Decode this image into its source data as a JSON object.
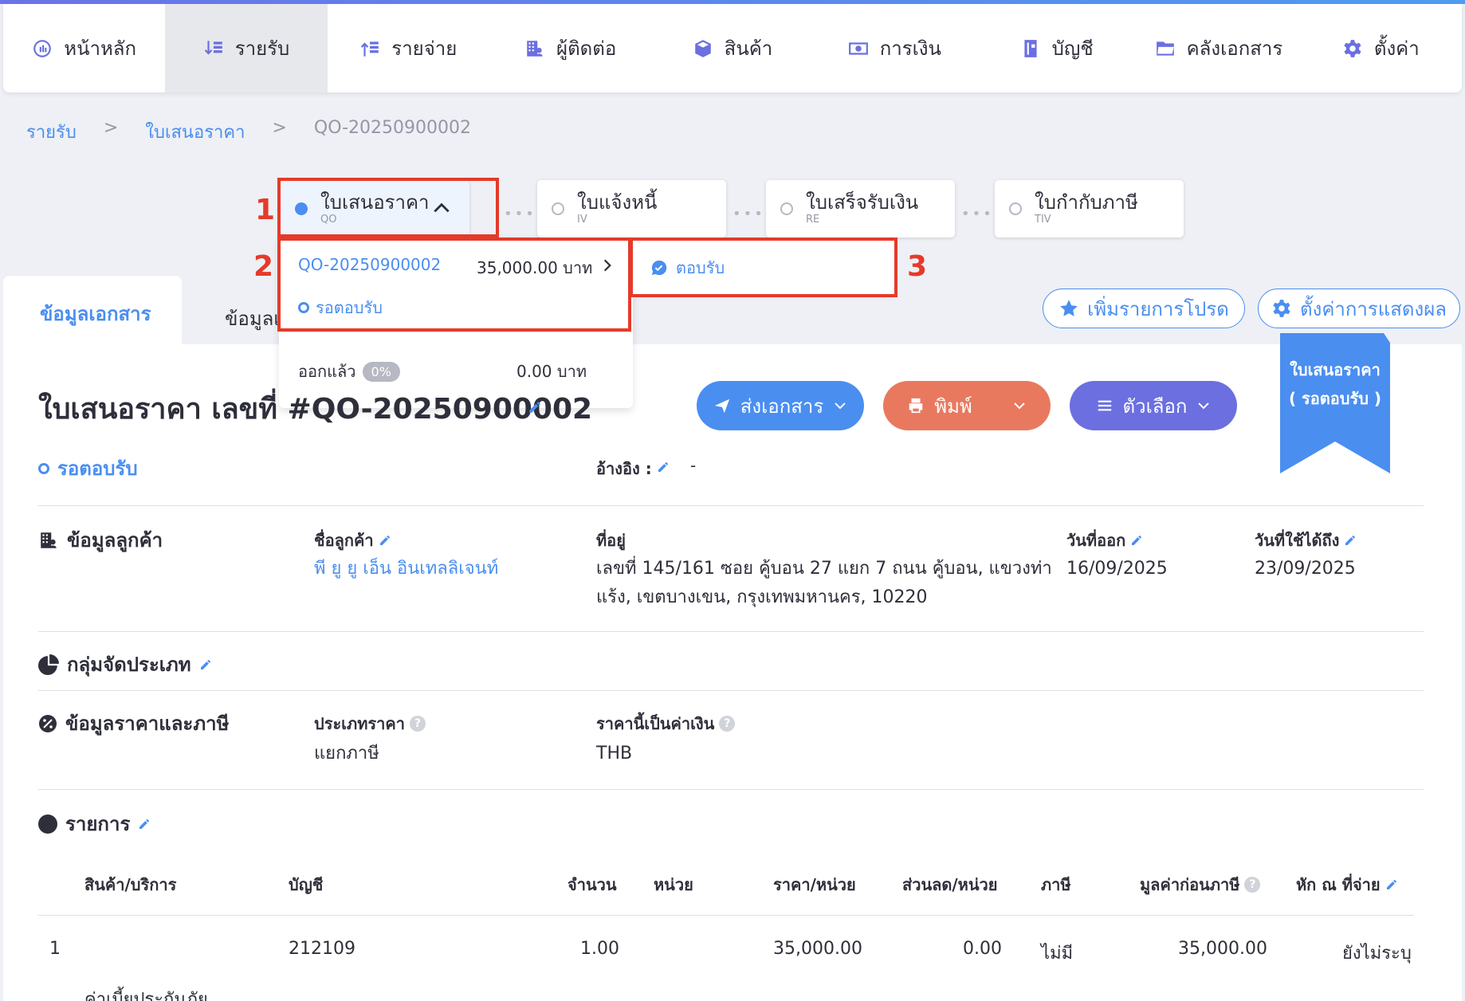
{
  "nav": [
    {
      "label": "หน้าหลัก",
      "icon": "dashboard-icon",
      "active": false
    },
    {
      "label": "รายรับ",
      "icon": "income-icon",
      "active": true
    },
    {
      "label": "รายจ่าย",
      "icon": "expense-icon",
      "active": false
    },
    {
      "label": "ผู้ติดต่อ",
      "icon": "contacts-icon",
      "active": false
    },
    {
      "label": "สินค้า",
      "icon": "box-icon",
      "active": false
    },
    {
      "label": "การเงิน",
      "icon": "money-icon",
      "active": false
    },
    {
      "label": "บัญชี",
      "icon": "book-icon",
      "active": false
    },
    {
      "label": "คลังเอกสาร",
      "icon": "folder-icon",
      "active": false
    },
    {
      "label": "ตั้งค่า",
      "icon": "gear-icon",
      "active": false
    }
  ],
  "breadcrumb": {
    "root": "รายรับ",
    "sep": ">",
    "section": "ใบเสนอราคา",
    "current": "QO-20250900002"
  },
  "steps": [
    {
      "title": "ใบเสนอราคา",
      "code": "QO"
    },
    {
      "title": "ใบแจ้งหนี้",
      "code": "IV"
    },
    {
      "title": "ใบเสร็จรับเงิน",
      "code": "RE"
    },
    {
      "title": "ใบกำกับภาษี",
      "code": "TIV"
    }
  ],
  "annotations": {
    "one": "1",
    "two": "2",
    "three": "3"
  },
  "dropdown": {
    "doc_no": "QO-20250900002",
    "amount": "35,000.00 บาท",
    "status": "รอตอบรับ",
    "issued_label": "ออกแล้ว",
    "issued_pct": "0%",
    "issued_amount": "0.00 บาท"
  },
  "accept_action": "ตอบรับ",
  "tabs": {
    "doc_info": "ข้อมูลเอกสาร",
    "other": "ข้อมูลเ"
  },
  "buttons": {
    "add_favorite": "เพิ่มรายการโปรด",
    "display_settings": "ตั้งค่าการแสดงผล",
    "send": "ส่งเอกสาร",
    "print": "พิมพ์",
    "options": "ตัวเลือก"
  },
  "ribbon": {
    "line1": "ใบเสนอราคา",
    "line2": "( รอตอบรับ )"
  },
  "document": {
    "title": "ใบเสนอราคา เลขที่ #QO-20250900002",
    "status": "รอตอบรับ",
    "ref_label": "อ้างอิง :",
    "ref_value": "-"
  },
  "customer": {
    "section": "ข้อมูลลูกค้า",
    "name_label": "ชื่อลูกค้า",
    "name": "พี ยู ยู เอ็น อินเทลลิเจนท์",
    "address_label": "ที่อยู่",
    "address_line1": "เลขที่ 145/161 ซอย คู้บอน 27 แยก 7 ถนน คู้บอน, แขวงท่า",
    "address_line2": "แร้ง, เขตบางเขน, กรุงเทพมหานคร, 10220",
    "issue_label": "วันที่ออก",
    "issue_date": "16/09/2025",
    "valid_label": "วันที่ใช้ได้ถึง",
    "valid_date": "23/09/2025"
  },
  "group": {
    "section": "กลุ่มจัดประเภท"
  },
  "pricing": {
    "section": "ข้อมูลราคาและภาษี",
    "type_label": "ประเภทราคา",
    "type_value": "แยกภาษี",
    "currency_label": "ราคานี้เป็นค่าเงิน",
    "currency_value": "THB"
  },
  "items": {
    "section": "รายการ",
    "headers": [
      "สินค้า/บริการ",
      "บัญชี",
      "จำนวน",
      "หน่วย",
      "ราคา/หน่วย",
      "ส่วนลด/หน่วย",
      "ภาษี",
      "มูลค่าก่อนภาษี",
      "หัก ณ ที่จ่าย"
    ],
    "rows": [
      {
        "no": "1",
        "account": "212109",
        "qty": "1.00",
        "unit": "",
        "price": "35,000.00",
        "discount": "0.00",
        "tax": "ไม่มี",
        "subtotal": "35,000.00",
        "wht": "ยังไม่ระบุ",
        "desc": "ค่าเบี้ยประกันภัย"
      }
    ]
  },
  "colors": {
    "accent": "#4a8ef0",
    "red_annotation": "#e53a2a",
    "print": "#e8795f",
    "options": "#6b6fe0"
  }
}
